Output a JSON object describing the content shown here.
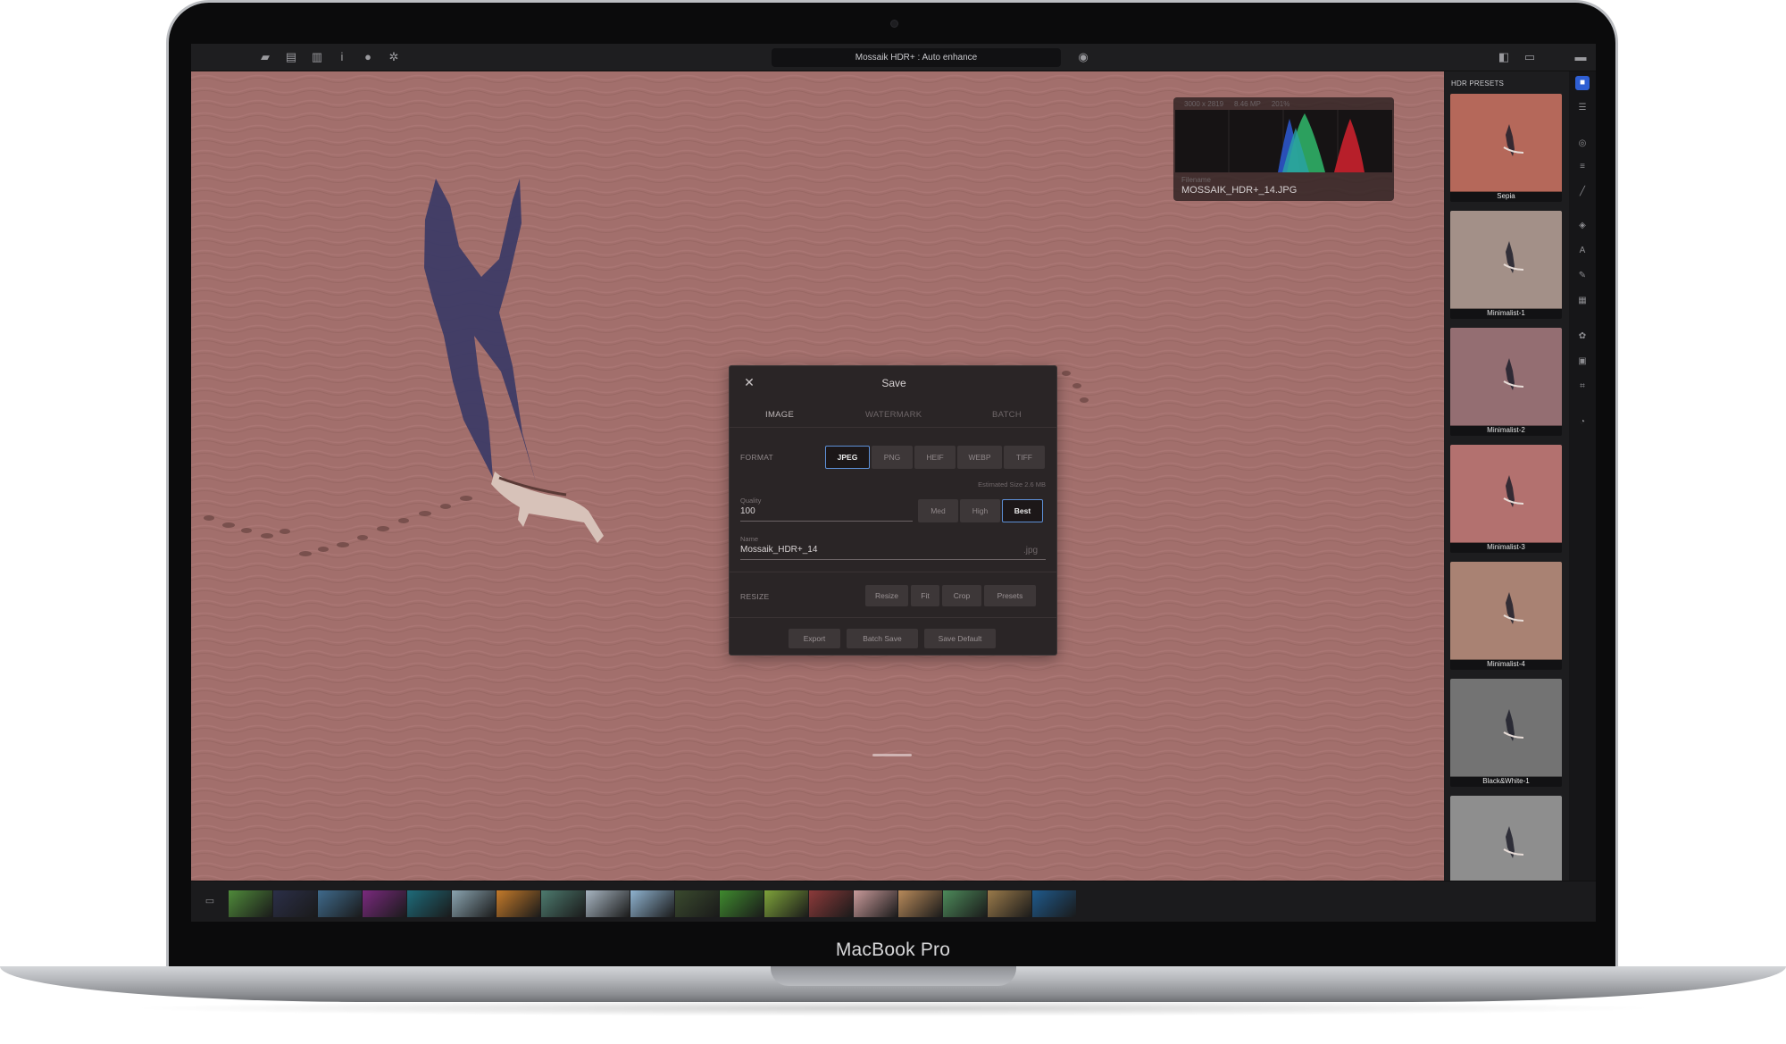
{
  "app": {
    "title": "Mossaik HDR+ : Auto enhance",
    "device_label": "MacBook Pro"
  },
  "toolbar": {
    "left_icons": [
      "folder-icon",
      "clipboard-icon",
      "histogram-icon",
      "info-i-icon",
      "info-circle-icon",
      "sparkle-icon"
    ],
    "right_icons": [
      "split-view-icon",
      "single-view-icon",
      "fullscreen-icon"
    ],
    "preview_icon": "eye-icon"
  },
  "histogram": {
    "dimensions": "3000 x 2819",
    "megapixels": "8.46 MP",
    "zoom": "201%",
    "filename_label": "Filename",
    "filename": "MOSSAIK_HDR+_14.JPG"
  },
  "dialog": {
    "close_glyph": "✕",
    "title": "Save",
    "tabs": [
      "IMAGE",
      "WATERMARK",
      "BATCH"
    ],
    "active_tab": "IMAGE",
    "format_label": "FORMAT",
    "formats": [
      "JPEG",
      "PNG",
      "HEIF",
      "WEBP",
      "TIFF"
    ],
    "selected_format": "JPEG",
    "estimated_size": "Estimated Size 2.6 MB",
    "quality_label": "Quality",
    "quality_value": "100",
    "quality_presets": [
      "Med",
      "High",
      "Best"
    ],
    "selected_quality": "Best",
    "name_label": "Name",
    "name_value": "Mossaik_HDR+_14",
    "extension": ".jpg",
    "resize_label": "RESIZE",
    "resize_buttons": [
      "Resize",
      "Fit",
      "Crop",
      "Presets"
    ],
    "footer_buttons": [
      "Export",
      "Batch Save",
      "Save Default"
    ]
  },
  "presets": {
    "title": "HDR PRESETS",
    "items": [
      {
        "label": "Sepia",
        "color": "#b5685a"
      },
      {
        "label": "Minimalist-1",
        "color": "#a39088"
      },
      {
        "label": "Minimalist-2",
        "color": "#946e72"
      },
      {
        "label": "Minimalist-3",
        "color": "#b3716f"
      },
      {
        "label": "Minimalist-4",
        "color": "#a98273"
      },
      {
        "label": "Black&White-1",
        "color": "#737373"
      },
      {
        "label": "",
        "color": "#8e8e8e"
      }
    ]
  },
  "rail_icons": [
    "layers-active-icon",
    "sliders-icon",
    "target-icon",
    "filter-icon",
    "brush-icon",
    "stack-icon",
    "text-icon",
    "pen-icon",
    "grid-icon",
    "flower-icon",
    "frame-icon",
    "crop-icon",
    "clock-icon"
  ],
  "filmstrip": {
    "icon": "image-library-icon",
    "thumbs": [
      "#4f8a3a",
      "#2b2f48",
      "#3f6a8c",
      "#7a2a7e",
      "#1e6b7a",
      "#8aa4b0",
      "#c47a2a",
      "#4d7a6e",
      "#a8b6c2",
      "#8fb3d0",
      "#3a4a2e",
      "#3f8a2e",
      "#7ea33a",
      "#8c3a3a",
      "#c99a9a",
      "#b88a5a",
      "#4d8a5a",
      "#9a7a4a",
      "#1f5a8c"
    ]
  },
  "colors": {
    "accent": "#2f5fd3",
    "canvas_tint": "#a26f6c",
    "dialog_bg": "#2a2526"
  }
}
